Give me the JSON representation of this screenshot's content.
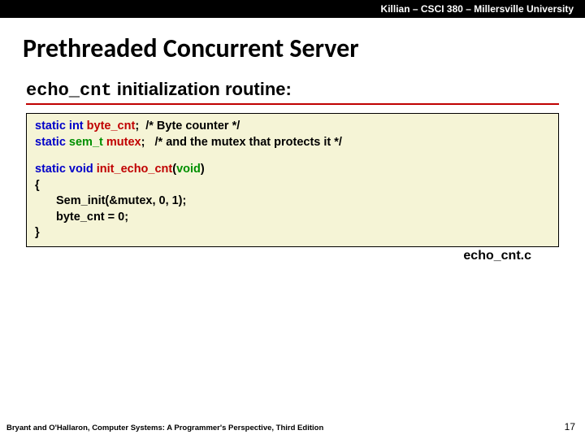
{
  "topbar": {
    "text": "Killian – CSCI 380 – Millersville University"
  },
  "title": "Prethreaded Concurrent Server",
  "subtitle": {
    "mono": "echo_cnt",
    "rest": " initialization routine:"
  },
  "code": {
    "l1": {
      "static": "static",
      "int": "int",
      "id": "byte_cnt",
      "semi": ";",
      "cm": "  /* Byte counter */"
    },
    "l2": {
      "static": "static",
      "ty": "sem_t",
      "id": "mutex",
      "semi": ";",
      "cm": "   /* and the mutex that protects it */"
    },
    "l3": {
      "static": "static",
      "void": "void",
      "fn": "init_echo_cnt",
      "paren_open": "(",
      "arg": "void",
      "paren_close": ")"
    },
    "l4": "{",
    "l5": "Sem_init(&mutex, 0, 1);",
    "l6": "byte_cnt = 0;",
    "l7": "}"
  },
  "codefile": "echo_cnt.c",
  "footer": {
    "left": "Bryant and O'Hallaron, Computer Systems: A Programmer's Perspective, Third Edition",
    "right": "17"
  }
}
